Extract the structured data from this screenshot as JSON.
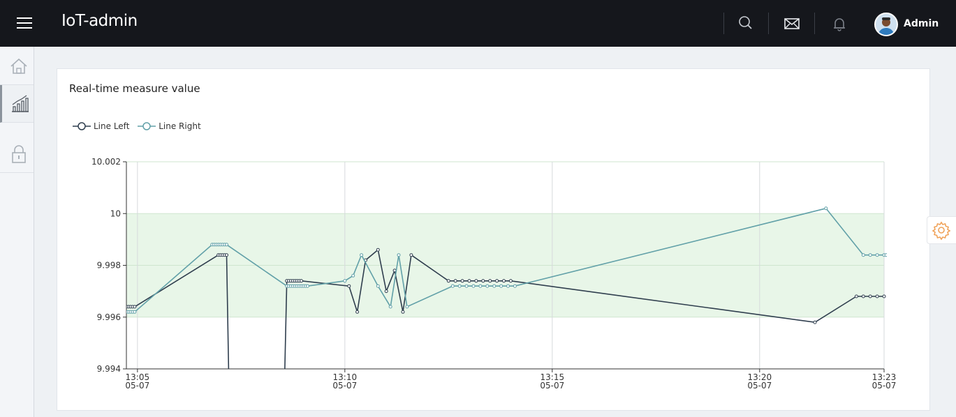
{
  "header": {
    "title": "IoT-admin",
    "user_name": "Admin",
    "icons": [
      "menu-icon",
      "search-icon",
      "mail-icon",
      "bell-icon",
      "avatar"
    ]
  },
  "sidebar": {
    "items": [
      {
        "name": "home",
        "icon": "home-icon"
      },
      {
        "name": "chart",
        "icon": "chart-icon",
        "active": true
      },
      {
        "name": "lock",
        "icon": "lock-icon"
      }
    ]
  },
  "card": {
    "title": "Real-time measure value"
  },
  "colors": {
    "line_left": "#2f3e4e",
    "line_right": "#61a0a8",
    "band_fill": "#e8f6e8",
    "settings_accent": "#f0a35a"
  },
  "chart_data": {
    "type": "line",
    "title": "",
    "xlabel": "",
    "ylabel": "",
    "ylim": [
      9.994,
      10.002
    ],
    "xlim": [
      "05-07 13:04:44",
      "05-07 13:23:00"
    ],
    "y_ticks": [
      "9.994",
      "9.996",
      "9.998",
      "10",
      "10.002"
    ],
    "x_ticks": [
      {
        "t": "05-07 13:05:00",
        "time": "13:05",
        "date": "05-07"
      },
      {
        "t": "05-07 13:10:00",
        "time": "13:10",
        "date": "05-07"
      },
      {
        "t": "05-07 13:15:00",
        "time": "13:15",
        "date": "05-07"
      },
      {
        "t": "05-07 13:20:00",
        "time": "13:20",
        "date": "05-07"
      },
      {
        "t": "05-07 13:23:00",
        "time": "13:23",
        "date": "05-07"
      }
    ],
    "band": [
      9.996,
      10.0
    ],
    "grid": true,
    "legend": "top-left",
    "series": [
      {
        "name": "Line Left",
        "points": [
          [
            "05-07 13:04:44",
            9.9964
          ],
          [
            "05-07 13:04:47",
            9.9964
          ],
          [
            "05-07 13:04:50",
            9.9964
          ],
          [
            "05-07 13:04:53",
            9.9964
          ],
          [
            "05-07 13:04:56",
            9.9964
          ],
          [
            "05-07 13:06:57",
            9.9984
          ],
          [
            "05-07 13:07:00",
            9.9984
          ],
          [
            "05-07 13:07:03",
            9.9984
          ],
          [
            "05-07 13:07:06",
            9.9984
          ],
          [
            "05-07 13:07:09",
            9.9984
          ],
          [
            "05-07 13:07:12",
            9.9938
          ],
          [
            "05-07 13:08:33",
            9.9938
          ],
          [
            "05-07 13:08:36",
            9.9974
          ],
          [
            "05-07 13:08:39",
            9.9974
          ],
          [
            "05-07 13:08:42",
            9.9974
          ],
          [
            "05-07 13:08:45",
            9.9974
          ],
          [
            "05-07 13:08:48",
            9.9974
          ],
          [
            "05-07 13:08:51",
            9.9974
          ],
          [
            "05-07 13:08:54",
            9.9974
          ],
          [
            "05-07 13:08:57",
            9.9974
          ],
          [
            "05-07 13:10:06",
            9.9972
          ],
          [
            "05-07 13:10:18",
            9.9962
          ],
          [
            "05-07 13:10:30",
            9.9982
          ],
          [
            "05-07 13:10:48",
            9.9986
          ],
          [
            "05-07 13:11:00",
            9.997
          ],
          [
            "05-07 13:11:12",
            9.9978
          ],
          [
            "05-07 13:11:24",
            9.9962
          ],
          [
            "05-07 13:11:36",
            9.9984
          ],
          [
            "05-07 13:12:30",
            9.9974
          ],
          [
            "05-07 13:12:40",
            9.9974
          ],
          [
            "05-07 13:12:50",
            9.9974
          ],
          [
            "05-07 13:13:00",
            9.9974
          ],
          [
            "05-07 13:13:10",
            9.9974
          ],
          [
            "05-07 13:13:20",
            9.9974
          ],
          [
            "05-07 13:13:30",
            9.9974
          ],
          [
            "05-07 13:13:40",
            9.9974
          ],
          [
            "05-07 13:13:50",
            9.9974
          ],
          [
            "05-07 13:14:00",
            9.9974
          ],
          [
            "05-07 13:21:20",
            9.9958
          ],
          [
            "05-07 13:22:20",
            9.9968
          ],
          [
            "05-07 13:22:30",
            9.9968
          ],
          [
            "05-07 13:22:40",
            9.9968
          ],
          [
            "05-07 13:22:50",
            9.9968
          ],
          [
            "05-07 13:23:00",
            9.9968
          ]
        ]
      },
      {
        "name": "Line Right",
        "points": [
          [
            "05-07 13:04:44",
            9.9962
          ],
          [
            "05-07 13:04:47",
            9.9962
          ],
          [
            "05-07 13:04:50",
            9.9962
          ],
          [
            "05-07 13:04:53",
            9.9962
          ],
          [
            "05-07 13:04:56",
            9.9962
          ],
          [
            "05-07 13:06:48",
            9.9988
          ],
          [
            "05-07 13:06:51",
            9.9988
          ],
          [
            "05-07 13:06:54",
            9.9988
          ],
          [
            "05-07 13:06:57",
            9.9988
          ],
          [
            "05-07 13:07:00",
            9.9988
          ],
          [
            "05-07 13:07:03",
            9.9988
          ],
          [
            "05-07 13:07:06",
            9.9988
          ],
          [
            "05-07 13:07:09",
            9.9988
          ],
          [
            "05-07 13:08:36",
            9.9972
          ],
          [
            "05-07 13:08:39",
            9.9972
          ],
          [
            "05-07 13:08:42",
            9.9972
          ],
          [
            "05-07 13:08:45",
            9.9972
          ],
          [
            "05-07 13:08:48",
            9.9972
          ],
          [
            "05-07 13:08:51",
            9.9972
          ],
          [
            "05-07 13:08:54",
            9.9972
          ],
          [
            "05-07 13:08:57",
            9.9972
          ],
          [
            "05-07 13:09:00",
            9.9972
          ],
          [
            "05-07 13:09:03",
            9.9972
          ],
          [
            "05-07 13:09:06",
            9.9972
          ],
          [
            "05-07 13:10:00",
            9.9974
          ],
          [
            "05-07 13:10:12",
            9.9976
          ],
          [
            "05-07 13:10:24",
            9.9984
          ],
          [
            "05-07 13:10:48",
            9.9972
          ],
          [
            "05-07 13:11:06",
            9.9964
          ],
          [
            "05-07 13:11:18",
            9.9984
          ],
          [
            "05-07 13:11:30",
            9.9964
          ],
          [
            "05-07 13:12:36",
            9.9972
          ],
          [
            "05-07 13:12:46",
            9.9972
          ],
          [
            "05-07 13:12:56",
            9.9972
          ],
          [
            "05-07 13:13:06",
            9.9972
          ],
          [
            "05-07 13:13:16",
            9.9972
          ],
          [
            "05-07 13:13:26",
            9.9972
          ],
          [
            "05-07 13:13:36",
            9.9972
          ],
          [
            "05-07 13:13:46",
            9.9972
          ],
          [
            "05-07 13:13:56",
            9.9972
          ],
          [
            "05-07 13:14:06",
            9.9972
          ],
          [
            "05-07 13:21:36",
            10.0002
          ],
          [
            "05-07 13:22:30",
            9.9984
          ],
          [
            "05-07 13:22:40",
            9.9984
          ],
          [
            "05-07 13:22:50",
            9.9984
          ],
          [
            "05-07 13:23:00",
            9.9984
          ],
          [
            "05-07 13:23:03",
            9.9984
          ]
        ]
      }
    ]
  }
}
